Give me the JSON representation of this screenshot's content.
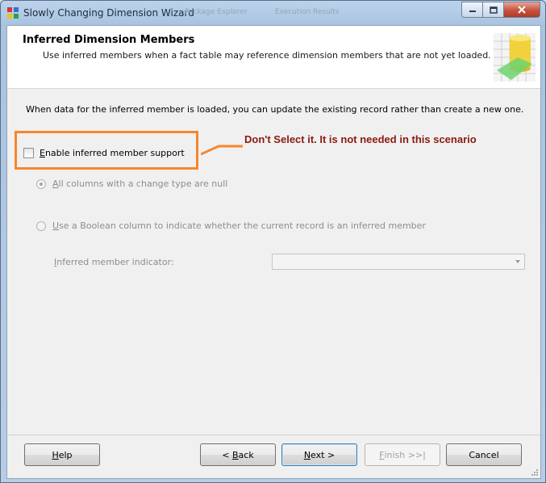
{
  "window": {
    "title": "Slowly Changing Dimension Wizard",
    "background_tabs": [
      "Package Explorer",
      "Execution Results"
    ],
    "controls": {
      "minimize": "minimize-icon",
      "maximize": "maximize-icon",
      "close": "close-icon"
    }
  },
  "header": {
    "title": "Inferred Dimension Members",
    "subtitle": "Use inferred members when a fact table may reference dimension members that are not yet loaded."
  },
  "body": {
    "description": "When data for the inferred member is loaded, you can update the existing record rather than create a new one.",
    "enable_checkbox": {
      "label_hotkey": "E",
      "label_rest": "nable inferred member support",
      "checked": false
    },
    "radio_null": {
      "label_hotkey": "A",
      "label_rest": "ll columns with a change type are null",
      "selected": true,
      "enabled": false
    },
    "radio_boolean": {
      "label_hotkey": "U",
      "label_rest": "se a Boolean column to indicate whether the current record is an inferred member",
      "selected": false,
      "enabled": false
    },
    "indicator": {
      "label_hotkey": "I",
      "label_rest": "nferred member indicator:",
      "value": ""
    }
  },
  "annotation": {
    "text": "Don't Select it. It is not needed in this scenario",
    "color": "#8b1a12",
    "highlight_color": "#f7862d"
  },
  "buttons": {
    "help": {
      "hotkey": "H",
      "rest": "elp"
    },
    "back": {
      "prefix": "< ",
      "hotkey": "B",
      "rest": "ack"
    },
    "next": {
      "hotkey": "N",
      "rest": "ext >"
    },
    "finish": {
      "hotkey": "F",
      "rest": "inish >>|"
    },
    "cancel": {
      "label": "Cancel"
    }
  }
}
